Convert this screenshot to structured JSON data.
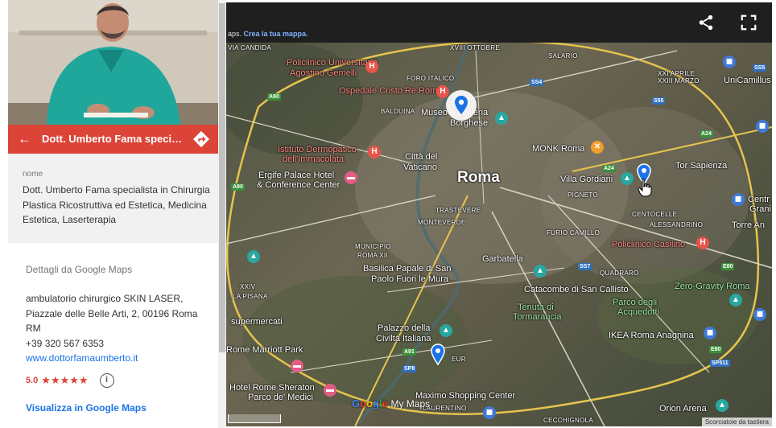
{
  "panel": {
    "title": "Dott. Umberto Fama specialist…",
    "name_label": "nome",
    "name_value": "Dott. Umberto Fama specialista in Chirurgia Plastica Ricostruttiva ed Estetica, Medicina Estetica, Laserterapia",
    "details_heading": "Dettagli da Google Maps",
    "address_line1": "ambulatorio chirurgico SKIN LASER,",
    "address_line2": "Piazzale delle Belle Arti, 2, 00196 Roma",
    "address_line3": "RM",
    "phone": "+39 320 567 6353",
    "website": "www.dottorfamaumberto.it",
    "rating_value": "5.0",
    "rating_stars": "★★★★★",
    "view_link": "Visualizza in Google Maps"
  },
  "map": {
    "credit_prefix": "aps.",
    "credit_link": "Crea la tua mappa.",
    "shortcuts": "Scorciatoie da tastiera",
    "city": "Roma",
    "labels": {
      "via_candida": "VIA CANDIDA",
      "policlinico": "Policlinico Universitario",
      "agostino": "Agostino Gemelli",
      "xviii": "XVIII OTTOBRE",
      "salario": "SALARIO",
      "foro": "FORO ITALICO",
      "ospedale": "Ospedale Cristo Re Roma",
      "balduina": "BALDUINA",
      "museo": "Museo e Galleria",
      "borghese": "Borghese",
      "xxi": "XXI APRILE",
      "xxiii": "XXIII MARZO",
      "uni_camillus": "UniCamillus",
      "istituto1": "Istituto Dermopatico",
      "istituto2": "dell'Immacolata",
      "citta1": "Città del",
      "citta2": "Vaticano",
      "monk": "MONK Roma",
      "ergife1": "Ergife Palace Hotel",
      "ergife2": "& Conference Center",
      "villa": "Villa Gordiani",
      "tor_sapienza": "Tor Sapienza",
      "pigneto": "PIGNETO",
      "centocelle": "CENTOCELLE",
      "alessandrino": "ALESSANDRINO",
      "trastevere": "TRASTEVERE",
      "monteverde": "MONTEVERDE",
      "foro_camillo": "FURIO CAMILLO",
      "torre_angela": "Torre An",
      "centro_grande1": "Centr",
      "centro_grande2": "Grani",
      "casilino": "Policlinico Casilino",
      "municipio1": "MUNICIPIO",
      "municipio2": "ROMA XII",
      "basilica1": "Basilica Papale di San",
      "basilica2": "Paolo Fuori le Mura",
      "garbatella": "Garbatella",
      "quadraro": "QUADRARO",
      "zero_gravity": "Zero-Gravity Roma",
      "catacombe": "Catacombe di San Callisto",
      "parco_acquedotti1": "Parco degli",
      "parco_acquedotti2": "Acquedotti",
      "tenuta1": "Tenuta di",
      "tenuta2": "Tormarancia",
      "pisana": "LA PISANA",
      "xxiv": "XXIV",
      "palazzo1": "Palazzo della",
      "palazzo2": "Civiltà Italiana",
      "ikea": "IKEA Roma Anagnina",
      "supermercati": "supermercati",
      "marriott": "Rome Marriott Park",
      "eur": "EUR",
      "sheraton1": "Hotel Rome Sheraton",
      "sheraton2": "Parco de' Medici",
      "maximo": "Maximo Shopping Center",
      "laurentino": "LAURENTINO",
      "orion": "Orion Arena",
      "cecchignola": "CECCHIGNOLA"
    },
    "shields": {
      "a90a": "A90",
      "a90b": "A90",
      "ss4": "SS4",
      "ss5": "SS5",
      "s55": "S55",
      "a24a": "A24",
      "a24b": "A24",
      "ss7": "SS7",
      "e80a": "E80",
      "e80b": "E80",
      "a91": "A91",
      "sp8": "SP8",
      "sp511": "SP511"
    }
  },
  "logo": {
    "g1": "G",
    "o1": "o",
    "o2": "o",
    "g2": "g",
    "l": "l",
    "e": "e",
    "my": "My Maps"
  },
  "colors": {
    "header": "#db4437",
    "link": "#1a73e8",
    "pin": "#1a73e8"
  }
}
